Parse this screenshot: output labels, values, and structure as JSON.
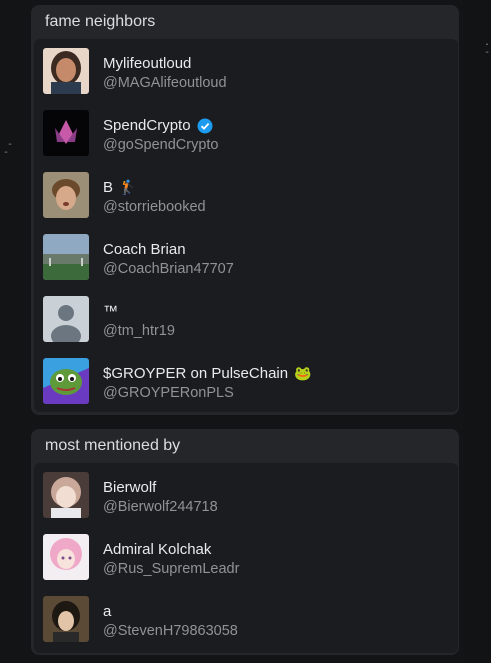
{
  "fame_neighbors": {
    "title": "fame neighbors",
    "items": [
      {
        "name": "Mylifeoutloud",
        "handle": "@MAGAlifeoutloud",
        "verified": false,
        "name_emoji": ""
      },
      {
        "name": "SpendCrypto",
        "handle": "@goSpendCrypto",
        "verified": true,
        "name_emoji": ""
      },
      {
        "name": "B",
        "handle": "@storriebooked",
        "verified": false,
        "name_emoji": "🏌"
      },
      {
        "name": "Coach Brian",
        "handle": "@CoachBrian47707",
        "verified": false,
        "name_emoji": ""
      },
      {
        "name": "™",
        "handle": "@tm_htr19",
        "verified": false,
        "name_emoji": ""
      },
      {
        "name": "$GROYPER on PulseChain",
        "handle": "@GROYPERonPLS",
        "verified": false,
        "name_emoji": "🐸"
      }
    ]
  },
  "most_mentioned_by": {
    "title": "most mentioned by",
    "items": [
      {
        "name": "Bierwolf",
        "handle": "@Bierwolf244718"
      },
      {
        "name": "Admiral Kolchak",
        "handle": "@Rus_SupremLeadr"
      },
      {
        "name": "a",
        "handle": "@StevenH79863058"
      }
    ]
  },
  "colors": {
    "verified_badge": "#1d9bf0",
    "panel_bg": "#24262a",
    "list_bg": "#1b1c1f"
  }
}
